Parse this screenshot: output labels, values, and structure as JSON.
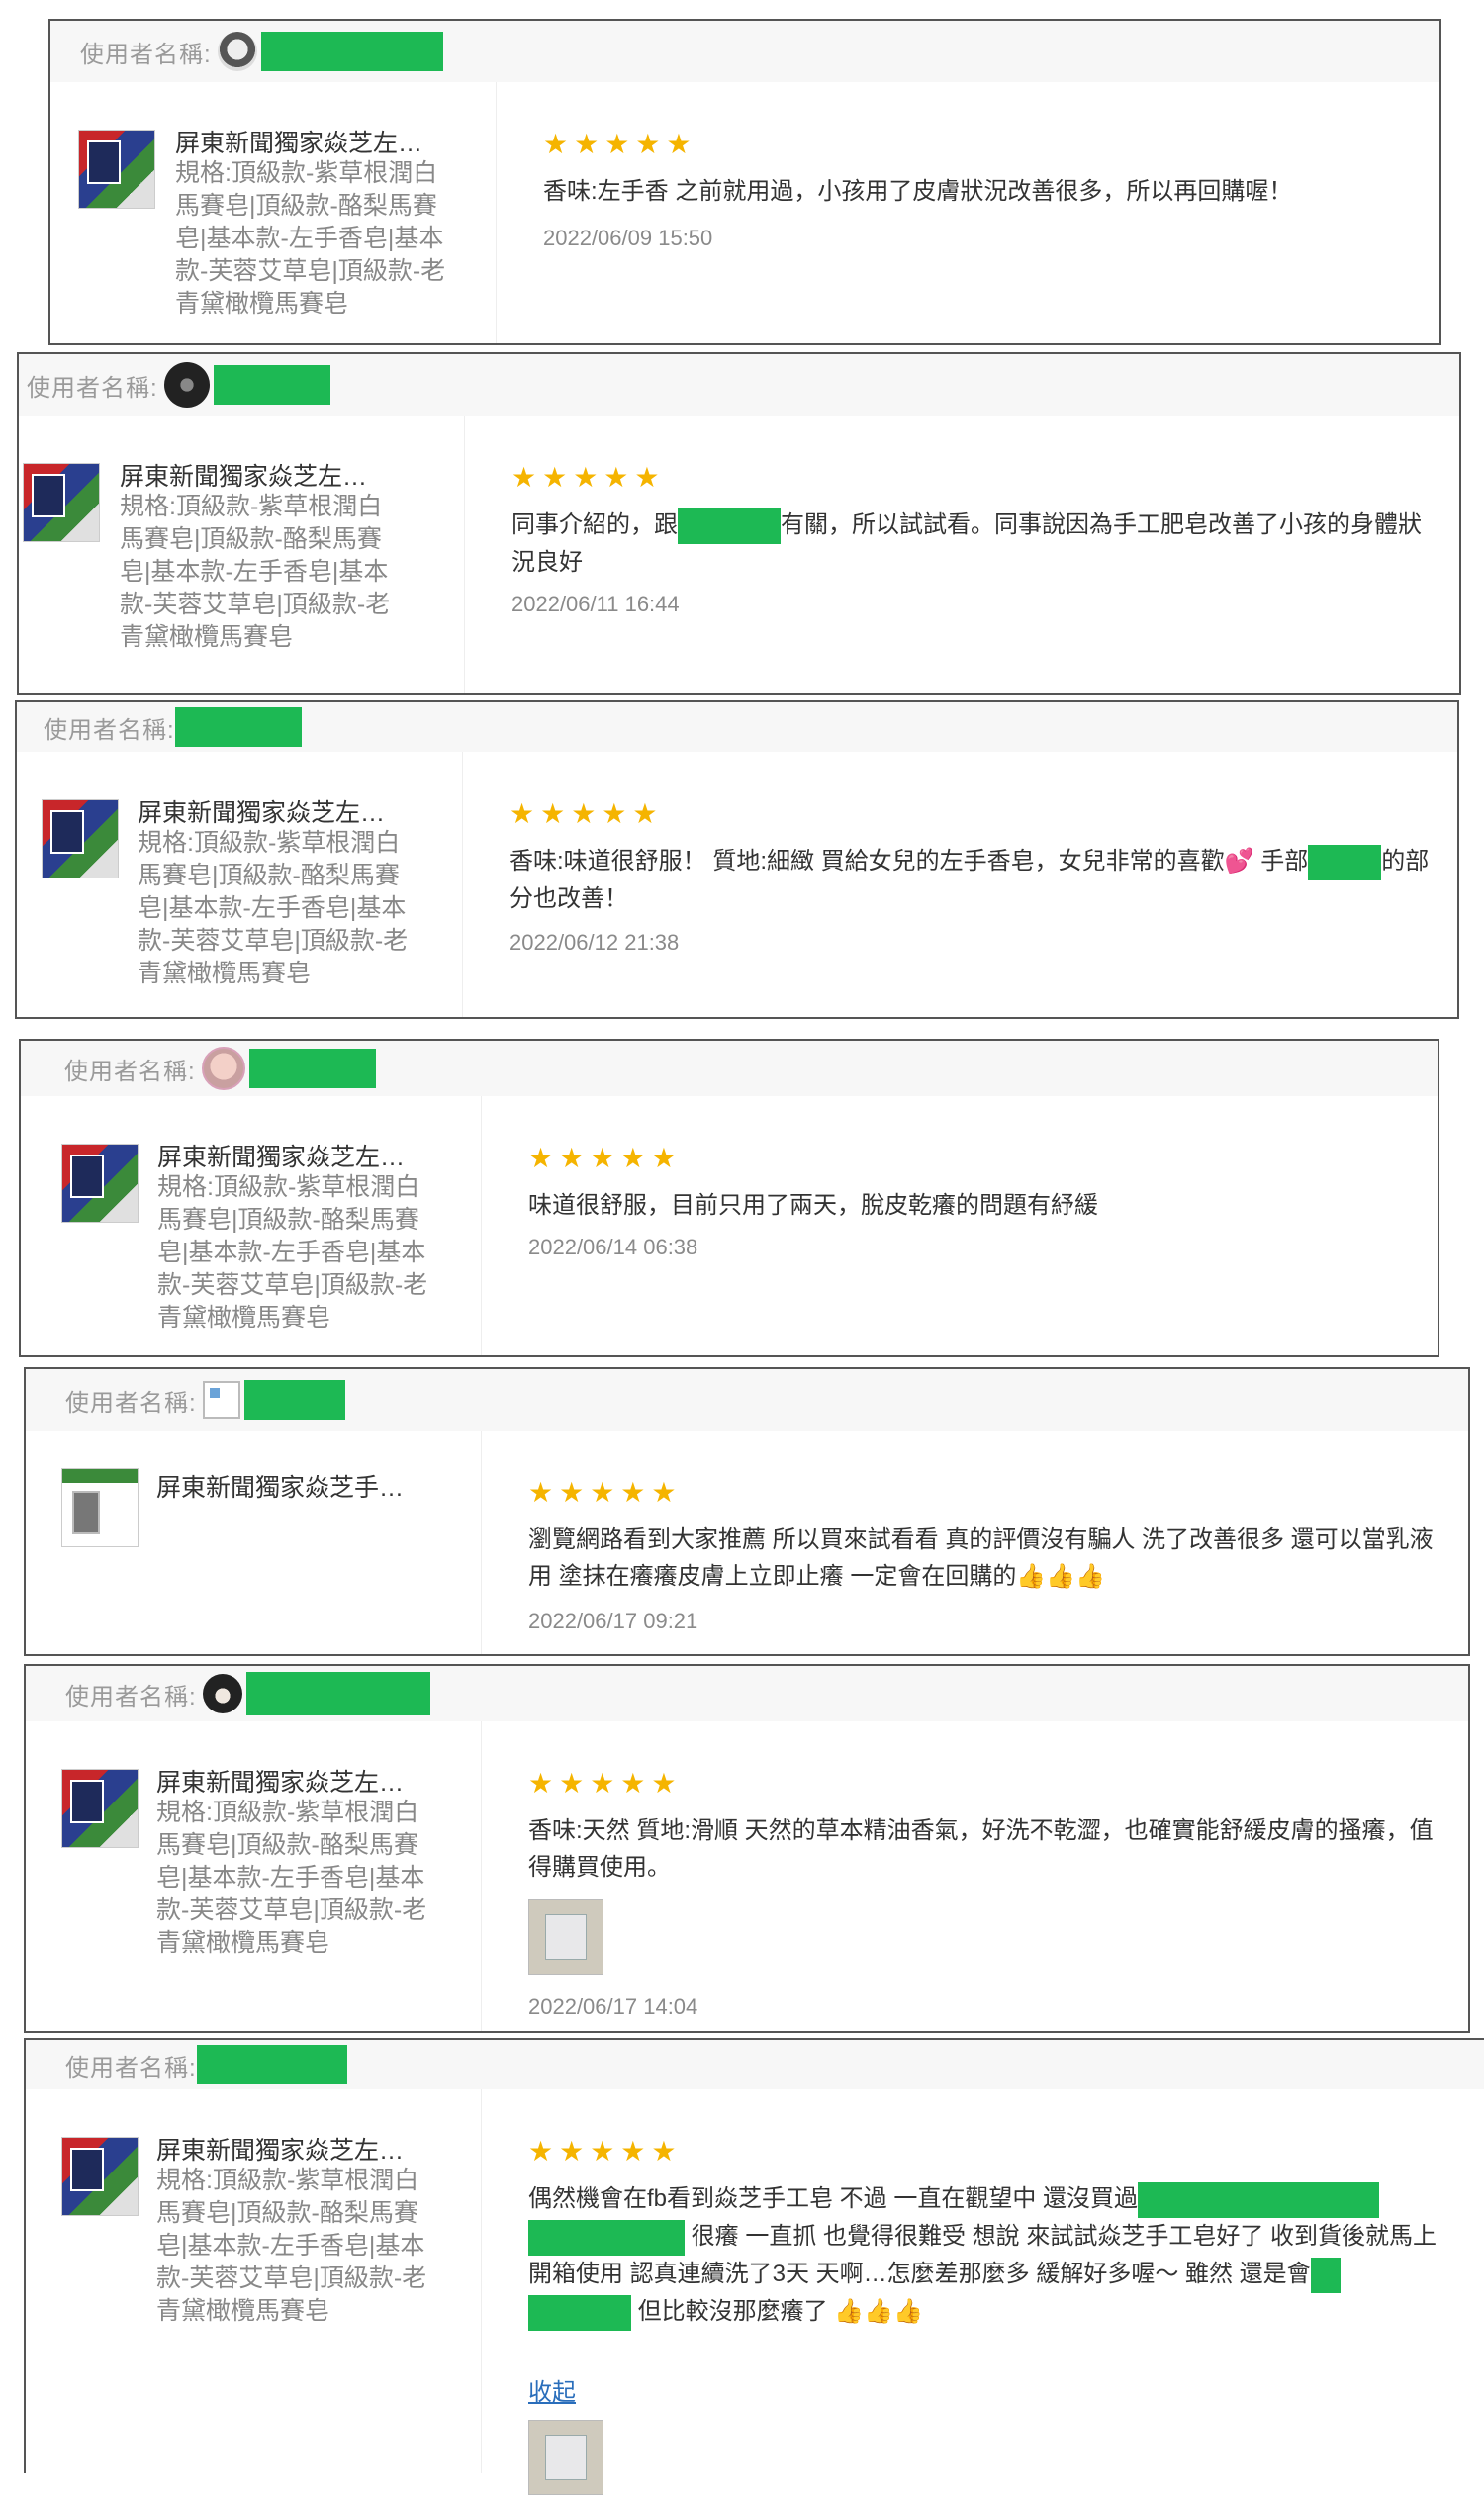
{
  "labels": {
    "username": "使用者名稱:",
    "collapse": "收起"
  },
  "colors": {
    "star": "#f5b400",
    "redaction": "#1db954",
    "link": "#2a6ebb"
  },
  "reviews": [
    {
      "product_name": "屏東新聞獨家焱芝左…",
      "spec": "規格:頂級款-紫草根潤白馬賽皂|頂級款-酪梨馬賽皂|基本款-左手香皂|基本款-芙蓉艾草皂|頂級款-老青黛橄欖馬賽皂",
      "stars": "★★★★★",
      "text": "香味:左手香 之前就用過，小孩用了皮膚狀況改善很多，所以再回購喔！",
      "date": "2022/06/09 15:50"
    },
    {
      "product_name": "屏東新聞獨家焱芝左…",
      "spec": "規格:頂級款-紫草根潤白馬賽皂|頂級款-酪梨馬賽皂|基本款-左手香皂|基本款-芙蓉艾草皂|頂級款-老青黛橄欖馬賽皂",
      "stars": "★★★★★",
      "text_a": "同事介紹的，跟",
      "text_b": "有關，所以試試看。同事說因為手工肥皂改善了小孩的身體狀況良好",
      "date": "2022/06/11 16:44"
    },
    {
      "product_name": "屏東新聞獨家焱芝左…",
      "spec": "規格:頂級款-紫草根潤白馬賽皂|頂級款-酪梨馬賽皂|基本款-左手香皂|基本款-芙蓉艾草皂|頂級款-老青黛橄欖馬賽皂",
      "stars": "★★★★★",
      "text_a": "香味:味道很舒服！ 質地:細緻 買給女兒的左手香皂，女兒非常的喜歡💕 手部",
      "text_b": "的部分也改善！",
      "date": "2022/06/12 21:38"
    },
    {
      "product_name": "屏東新聞獨家焱芝左…",
      "spec": "規格:頂級款-紫草根潤白馬賽皂|頂級款-酪梨馬賽皂|基本款-左手香皂|基本款-芙蓉艾草皂|頂級款-老青黛橄欖馬賽皂",
      "stars": "★★★★★",
      "text": "味道很舒服，目前只用了兩天，脫皮乾癢的問題有紓緩",
      "date": "2022/06/14 06:38"
    },
    {
      "product_name": "屏東新聞獨家焱芝手…",
      "stars": "★★★★★",
      "text": "瀏覽網路看到大家推薦 所以買來試看看 真的評價沒有騙人 洗了改善很多 還可以當乳液用 塗抹在癢癢皮膚上立即止癢 一定會在回購的👍👍👍",
      "date": "2022/06/17 09:21"
    },
    {
      "product_name": "屏東新聞獨家焱芝左…",
      "spec": "規格:頂級款-紫草根潤白馬賽皂|頂級款-酪梨馬賽皂|基本款-左手香皂|基本款-芙蓉艾草皂|頂級款-老青黛橄欖馬賽皂",
      "stars": "★★★★★",
      "text": "香味:天然 質地:滑順 天然的草本精油香氣，好洗不乾澀，也確實能舒緩皮膚的搔癢，值得購買使用。",
      "date": "2022/06/17 14:04"
    },
    {
      "product_name": "屏東新聞獨家焱芝左…",
      "spec": "規格:頂級款-紫草根潤白馬賽皂|頂級款-酪梨馬賽皂|基本款-左手香皂|基本款-芙蓉艾草皂|頂級款-老青黛橄欖馬賽皂",
      "stars": "★★★★★",
      "text_a": "偶然機會在fb看到焱芝手工皂 不過 一直在觀望中 還沒買過",
      "text_b": "很癢 一直抓 也覺得很難受 想說 來試試焱芝手工皂好了 收到貨後就馬上開箱使用 認真連續洗了3天 天啊…怎麼差那麼多 緩解好多喔～ 雖然 還是會",
      "text_c": "但比較沒那麼癢了 👍👍👍"
    }
  ]
}
